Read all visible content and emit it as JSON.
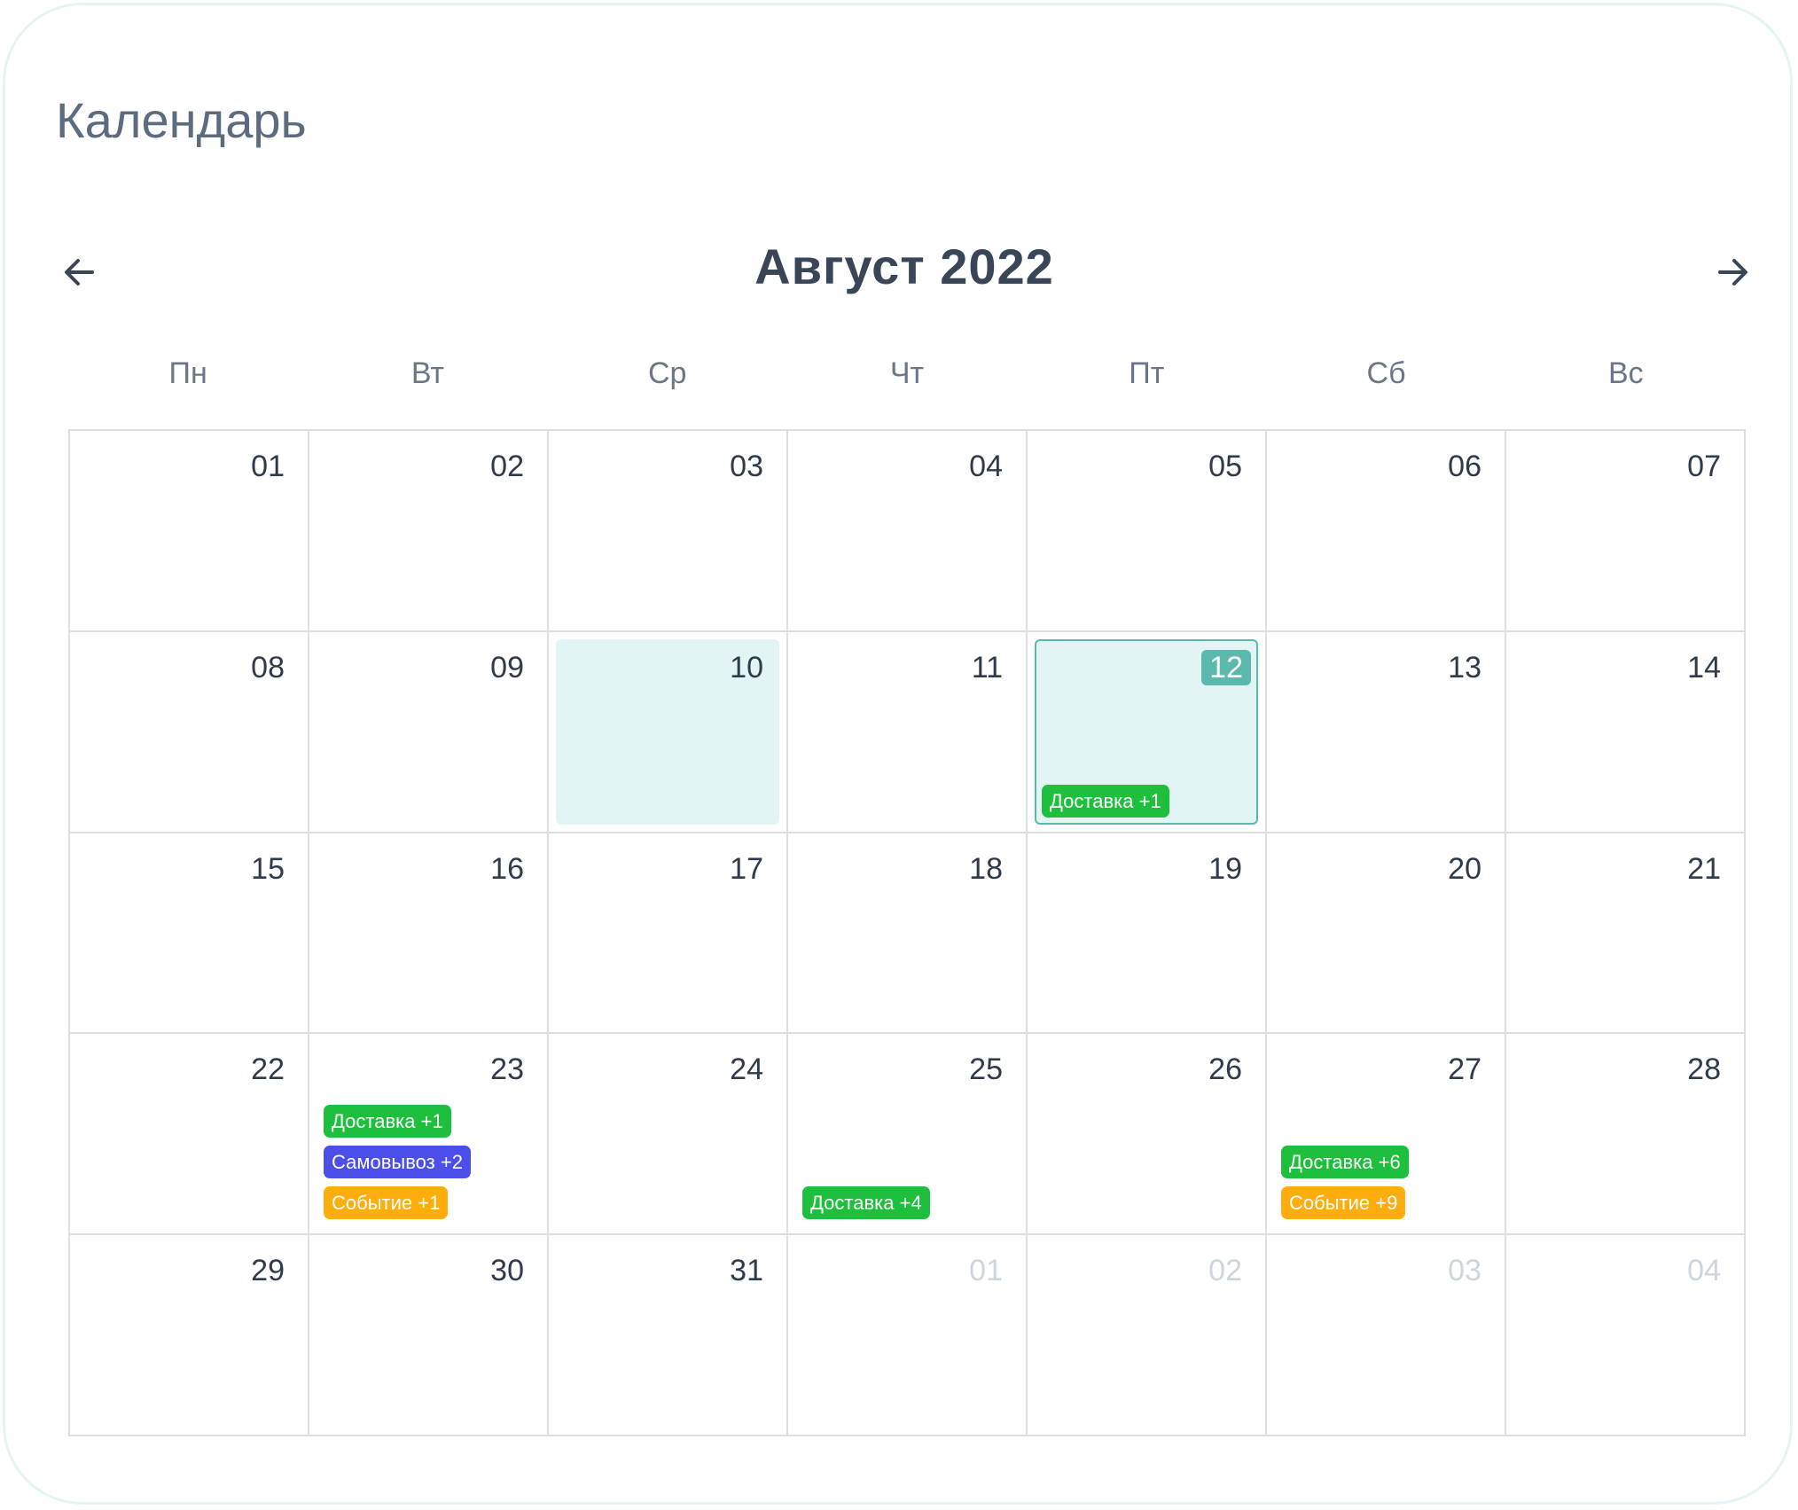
{
  "page": {
    "title": "Календарь"
  },
  "calendar": {
    "month_label": "Август 2022",
    "weekdays": [
      "Пн",
      "Вт",
      "Ср",
      "Чт",
      "Пт",
      "Сб",
      "Вс"
    ],
    "days": [
      {
        "label": "01",
        "other_month": false,
        "events": []
      },
      {
        "label": "02",
        "other_month": false,
        "events": []
      },
      {
        "label": "03",
        "other_month": false,
        "events": []
      },
      {
        "label": "04",
        "other_month": false,
        "events": []
      },
      {
        "label": "05",
        "other_month": false,
        "events": []
      },
      {
        "label": "06",
        "other_month": false,
        "events": []
      },
      {
        "label": "07",
        "other_month": false,
        "events": []
      },
      {
        "label": "08",
        "other_month": false,
        "events": []
      },
      {
        "label": "09",
        "other_month": false,
        "events": []
      },
      {
        "label": "10",
        "other_month": false,
        "selected": true,
        "events": []
      },
      {
        "label": "11",
        "other_month": false,
        "events": []
      },
      {
        "label": "12",
        "other_month": false,
        "today": true,
        "events": [
          {
            "label": "Доставка +1",
            "kind": "delivery"
          }
        ]
      },
      {
        "label": "13",
        "other_month": false,
        "events": []
      },
      {
        "label": "14",
        "other_month": false,
        "events": []
      },
      {
        "label": "15",
        "other_month": false,
        "events": []
      },
      {
        "label": "16",
        "other_month": false,
        "events": []
      },
      {
        "label": "17",
        "other_month": false,
        "events": []
      },
      {
        "label": "18",
        "other_month": false,
        "events": []
      },
      {
        "label": "19",
        "other_month": false,
        "events": []
      },
      {
        "label": "20",
        "other_month": false,
        "events": []
      },
      {
        "label": "21",
        "other_month": false,
        "events": []
      },
      {
        "label": "22",
        "other_month": false,
        "events": []
      },
      {
        "label": "23",
        "other_month": false,
        "events": [
          {
            "label": "Доставка +1",
            "kind": "delivery"
          },
          {
            "label": "Самовывоз +2",
            "kind": "pickup"
          },
          {
            "label": "Событие +1",
            "kind": "event-type"
          }
        ]
      },
      {
        "label": "24",
        "other_month": false,
        "events": []
      },
      {
        "label": "25",
        "other_month": false,
        "events": [
          {
            "label": "Доставка +4",
            "kind": "delivery"
          }
        ]
      },
      {
        "label": "26",
        "other_month": false,
        "events": []
      },
      {
        "label": "27",
        "other_month": false,
        "events": [
          {
            "label": "Доставка +6",
            "kind": "delivery"
          },
          {
            "label": "Событие +9",
            "kind": "event-type"
          }
        ]
      },
      {
        "label": "28",
        "other_month": false,
        "events": []
      },
      {
        "label": "29",
        "other_month": false,
        "events": []
      },
      {
        "label": "30",
        "other_month": false,
        "events": []
      },
      {
        "label": "31",
        "other_month": false,
        "events": []
      },
      {
        "label": "01",
        "other_month": true,
        "events": []
      },
      {
        "label": "02",
        "other_month": true,
        "events": []
      },
      {
        "label": "03",
        "other_month": true,
        "events": []
      },
      {
        "label": "04",
        "other_month": true,
        "events": []
      }
    ]
  },
  "icons": {
    "prev": "arrow-left-icon",
    "next": "arrow-right-icon"
  },
  "colors": {
    "delivery": "#1dbf3c",
    "pickup": "#4b4ee8",
    "event": "#ffad0d",
    "selected_bg": "#e2f4f3",
    "accent": "#5bb8ad"
  }
}
